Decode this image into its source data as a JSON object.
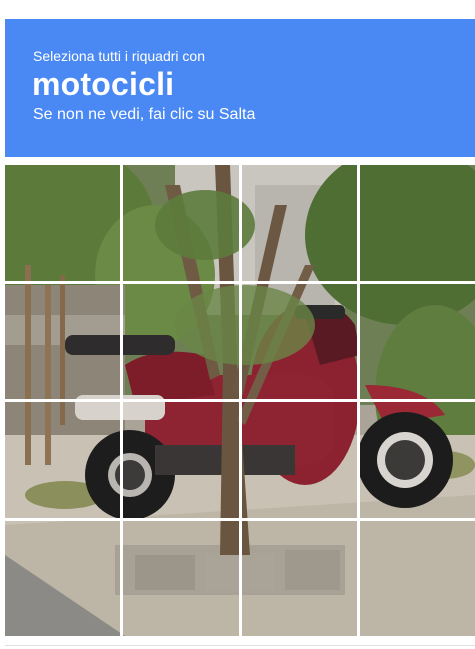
{
  "header": {
    "instruction": "Seleziona tutti i riquadri con",
    "target": "motocicli",
    "hint": "Se non ne vedi, fai clic su Salta"
  },
  "grid": {
    "rows": 4,
    "cols": 4
  },
  "colors": {
    "header_bg": "#4a89f3",
    "header_text": "#ffffff",
    "grid_line": "#ffffff"
  }
}
